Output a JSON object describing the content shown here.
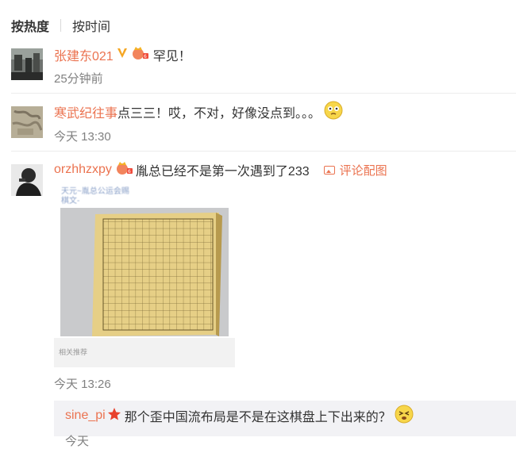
{
  "tabs": {
    "hot": "按热度",
    "time": "按时间"
  },
  "comments": [
    {
      "user": "张建东021",
      "text": "罕见！",
      "time": "25分钟前"
    },
    {
      "user": "寒武纪往事",
      "text": "点三三！哎，不对，好像没点到。。。",
      "time": "今天 13:30"
    },
    {
      "user": "orzhhzxpy",
      "text": "胤总已经不是第一次遇到了233",
      "pic_link": "评论配图",
      "time": "今天 13:26",
      "image": {
        "caption_line1": "天元~胤总公运会赐",
        "caption_line2": "棋文-",
        "footer": "相关推荐"
      }
    }
  ],
  "reply": {
    "user": "sine_pi",
    "text": "那个歪中国流布局是不是在这棋盘上下出来的？",
    "time": "今天"
  },
  "colors": {
    "accent": "#eb7350",
    "muted": "#808080",
    "reply_bg": "#f2f2f5"
  },
  "icons": [
    "verified-v-icon",
    "member-crown-icon",
    "emoji-thinking-icon",
    "member-crown-icon",
    "image-icon",
    "star-icon",
    "emoji-tired-icon"
  ]
}
